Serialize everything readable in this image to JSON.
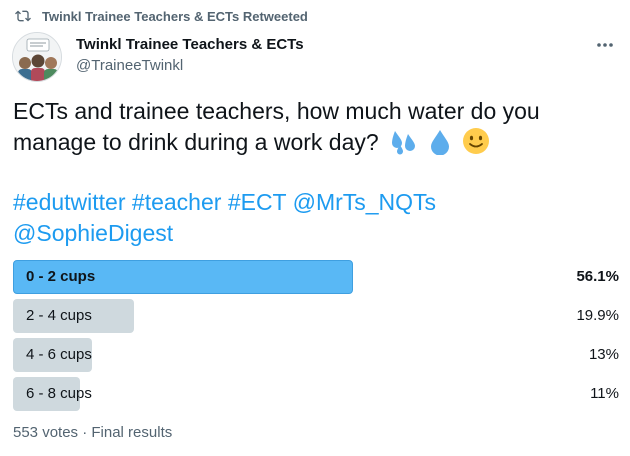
{
  "retweet": {
    "icon": "retweet-icon",
    "text": "Twinkl Trainee Teachers & ECTs Retweeted"
  },
  "author": {
    "name": "Twinkl Trainee Teachers & ECTs",
    "handle": "@TraineeTwinkl",
    "avatar_icon": "group-avatar"
  },
  "tweet": {
    "text": "ECTs and trainee teachers, how much water do you manage to drink during a work day?",
    "emojis": [
      "sweat-droplets-emoji",
      "droplet-emoji",
      "slightly-smiling-face-emoji"
    ],
    "tags": [
      "#edutwitter",
      "#teacher",
      "#ECT",
      "@MrTs_NQTs",
      "@SophieDigest"
    ]
  },
  "poll": {
    "options": [
      {
        "label": "0 - 2 cups",
        "percent_text": "56.1%",
        "percent": 56.1,
        "winner": true
      },
      {
        "label": "2 - 4 cups",
        "percent_text": "19.9%",
        "percent": 19.9,
        "winner": false
      },
      {
        "label": "4 - 6 cups",
        "percent_text": "13%",
        "percent": 13,
        "winner": false
      },
      {
        "label": "6 - 8 cups",
        "percent_text": "11%",
        "percent": 11,
        "winner": false
      }
    ],
    "footer": "553 votes · Final results"
  },
  "colors": {
    "accent": "#1d9bf0",
    "winner_bar": "#59b8f5",
    "loser_bar": "#cfd9de",
    "muted_text": "#536471"
  }
}
